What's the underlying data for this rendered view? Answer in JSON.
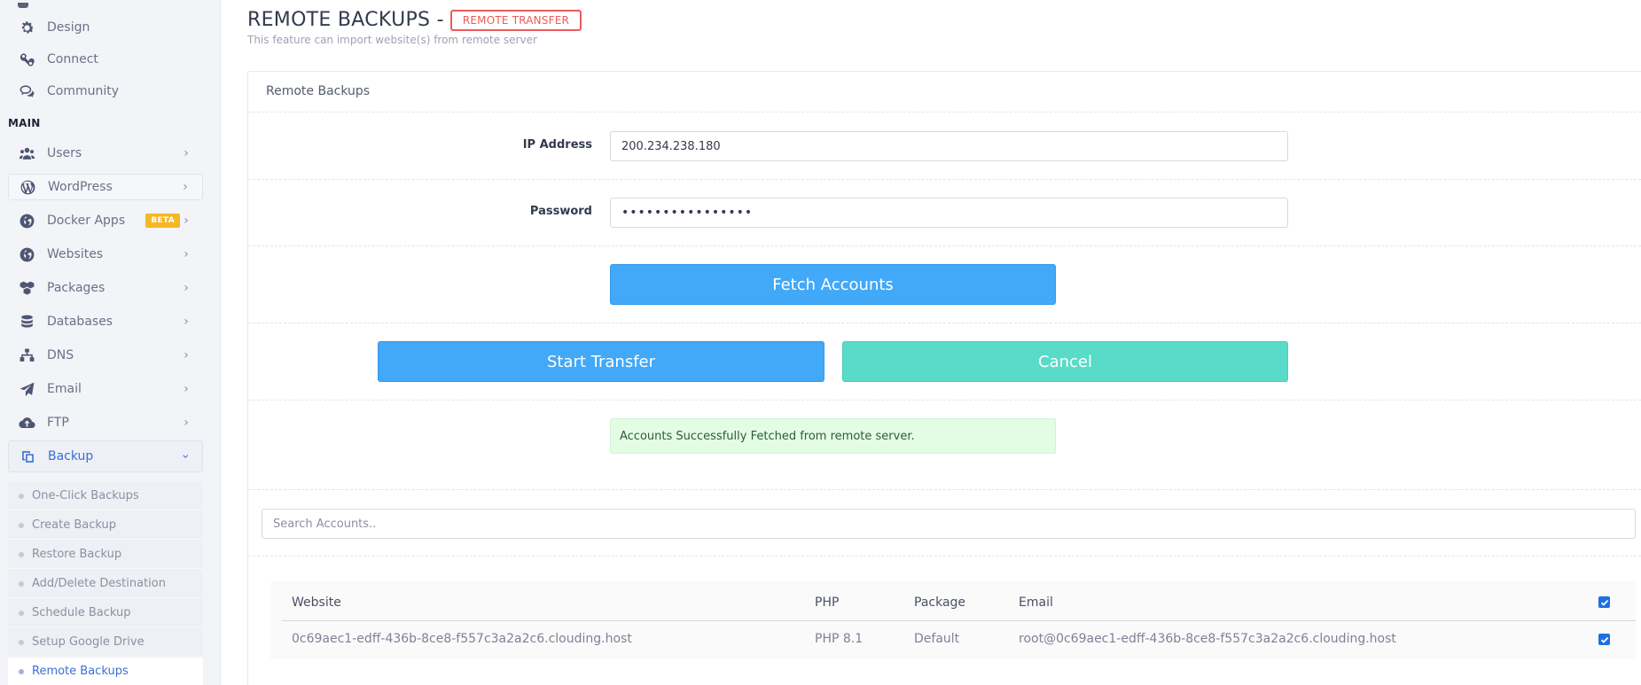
{
  "sidebar": {
    "top_items": [
      {
        "label": "Design",
        "icon": "gear-icon"
      },
      {
        "label": "Connect",
        "icon": "connect-icon"
      },
      {
        "label": "Community",
        "icon": "chat-icon"
      }
    ],
    "section_main": "MAIN",
    "main_items": [
      {
        "label": "Users",
        "icon": "users-icon"
      },
      {
        "label": "WordPress",
        "icon": "wordpress-icon"
      },
      {
        "label": "Docker Apps",
        "icon": "globe-icon",
        "badge": "BETA"
      },
      {
        "label": "Websites",
        "icon": "globe-icon"
      },
      {
        "label": "Packages",
        "icon": "packages-icon"
      },
      {
        "label": "Databases",
        "icon": "database-icon"
      },
      {
        "label": "DNS",
        "icon": "sitemap-icon"
      },
      {
        "label": "Email",
        "icon": "paper-plane-icon"
      },
      {
        "label": "FTP",
        "icon": "cloud-upload-icon"
      },
      {
        "label": "Backup",
        "icon": "backup-icon"
      }
    ],
    "backup_submenu": [
      "One-Click Backups",
      "Create Backup",
      "Restore Backup",
      "Add/Delete Destination",
      "Schedule Backup",
      "Setup Google Drive",
      "Remote Backups"
    ]
  },
  "header": {
    "title": "REMOTE BACKUPS -",
    "badge": "REMOTE TRANSFER",
    "subtitle": "This feature can import website(s) from remote server"
  },
  "panel": {
    "title": "Remote Backups",
    "ip_label": "IP Address",
    "ip_value": "200.234.238.180",
    "password_label": "Password",
    "password_value": "••••••••••••••••",
    "fetch_button": "Fetch Accounts",
    "start_button": "Start Transfer",
    "cancel_button": "Cancel",
    "alert": "Accounts Successfully Fetched from remote server.",
    "search_placeholder": "Search Accounts.."
  },
  "table": {
    "headers": [
      "Website",
      "PHP",
      "Package",
      "Email"
    ],
    "rows": [
      {
        "website": "0c69aec1-edff-436b-8ce8-f557c3a2a2c6.clouding.host",
        "php": "PHP 8.1",
        "package": "Default",
        "email": "root@0c69aec1-edff-436b-8ce8-f557c3a2a2c6.clouding.host",
        "checked": true
      }
    ],
    "select_all_checked": true
  },
  "colors": {
    "primary_button": "#42a8f8",
    "cancel_button": "#59dbc9",
    "badge_red": "#ee5a5a",
    "beta_badge": "#f5b722",
    "active_link": "#3a6fd1",
    "alert_bg": "#e3fde5"
  }
}
